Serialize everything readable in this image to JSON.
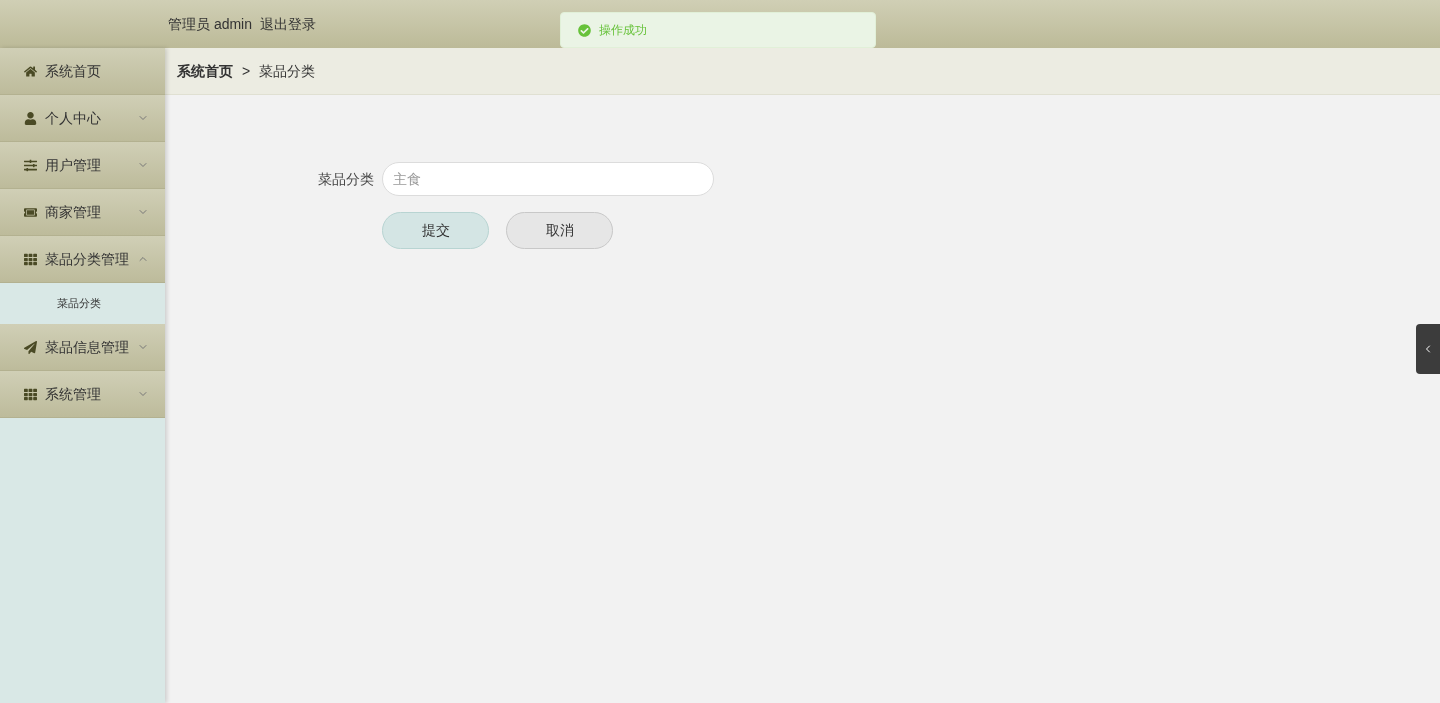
{
  "header": {
    "user_label": "管理员 admin",
    "logout": "退出登录"
  },
  "toast": {
    "message": "操作成功"
  },
  "sidebar": {
    "items": [
      {
        "label": "系统首页",
        "selected": false
      },
      {
        "label": "个人中心",
        "expanded": false,
        "selected": false
      },
      {
        "label": "用户管理",
        "expanded": false,
        "selected": false
      },
      {
        "label": "商家管理",
        "expanded": false,
        "selected": false
      },
      {
        "label": "菜品分类管理",
        "expanded": true,
        "selected": false,
        "children": [
          {
            "label": "菜品分类",
            "selected": true
          }
        ]
      },
      {
        "label": "菜品信息管理",
        "expanded": false,
        "selected": false
      },
      {
        "label": "系统管理",
        "expanded": false,
        "selected": false
      }
    ]
  },
  "breadcrumb": [
    {
      "label": "系统首页",
      "current": false
    },
    {
      "label": "菜品分类",
      "current": true
    }
  ],
  "breadcrumb_separator": ">",
  "form": {
    "fields": [
      {
        "label": "菜品分类",
        "placeholder": "主食"
      }
    ],
    "buttons": [
      {
        "label": "提交",
        "kind": "primary"
      },
      {
        "label": "取消",
        "kind": "secondary"
      }
    ]
  }
}
